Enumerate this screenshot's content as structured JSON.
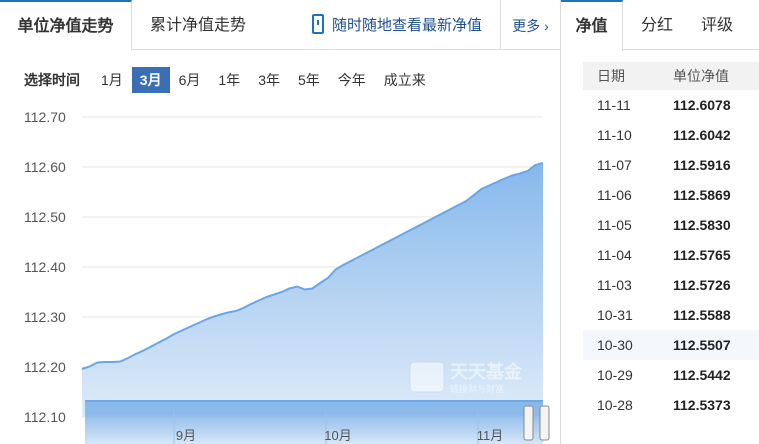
{
  "left_tabs": {
    "active": "单位净值走势",
    "second": "累计净值走势",
    "mobile_link": "随时随地查看最新净值",
    "more": "更多"
  },
  "time_range": {
    "label": "选择时间",
    "options": [
      "1月",
      "3月",
      "6月",
      "1年",
      "3年",
      "5年",
      "今年",
      "成立来"
    ],
    "selected": "3月"
  },
  "right_tabs": [
    "净值",
    "分红",
    "评级"
  ],
  "nav_table": {
    "headers": [
      "日期",
      "单位净值"
    ],
    "rows": [
      {
        "date": "11-11",
        "nav": "112.6078"
      },
      {
        "date": "11-10",
        "nav": "112.6042"
      },
      {
        "date": "11-07",
        "nav": "112.5916"
      },
      {
        "date": "11-06",
        "nav": "112.5869"
      },
      {
        "date": "11-05",
        "nav": "112.5830"
      },
      {
        "date": "11-04",
        "nav": "112.5765"
      },
      {
        "date": "11-03",
        "nav": "112.5726"
      },
      {
        "date": "10-31",
        "nav": "112.5588"
      },
      {
        "date": "10-30",
        "nav": "112.5507"
      },
      {
        "date": "10-29",
        "nav": "112.5442"
      },
      {
        "date": "10-28",
        "nav": "112.5373"
      }
    ]
  },
  "watermark": {
    "brand": "天天基金",
    "slogan": "链接财与财富"
  },
  "colors": {
    "accent": "#1e73be",
    "area": "#7fb4ea",
    "line": "#6aa6e6"
  },
  "chart_data": {
    "type": "area",
    "y_ticks": [
      "112.70",
      "112.60",
      "112.50",
      "112.40",
      "112.30",
      "112.20",
      "112.10"
    ],
    "ylim": [
      112.1,
      112.7
    ],
    "x_ticks": [
      "9月",
      "10月",
      "11月"
    ],
    "series": [
      {
        "values": [
          112.196,
          112.201,
          112.209,
          112.21,
          112.21,
          112.211,
          112.218,
          112.226,
          112.233,
          112.241,
          112.249,
          112.257,
          112.266,
          112.273,
          112.28,
          112.287,
          112.294,
          112.3,
          112.305,
          112.309,
          112.312,
          112.318,
          112.326,
          112.333,
          112.34,
          112.345,
          112.35,
          112.357,
          112.361,
          112.355,
          112.357,
          112.368,
          112.378,
          112.395,
          112.404,
          112.412,
          112.42,
          112.428,
          112.436,
          112.444,
          112.452,
          112.46,
          112.468,
          112.476,
          112.484,
          112.492,
          112.5,
          112.508,
          112.516,
          112.524,
          112.532,
          112.544,
          112.556,
          112.563,
          112.57,
          112.577,
          112.583,
          112.587,
          112.592,
          112.604,
          112.608
        ]
      }
    ],
    "grid": true
  }
}
